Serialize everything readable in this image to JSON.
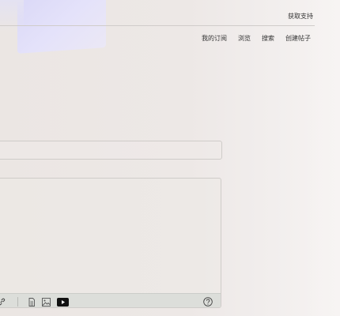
{
  "header": {
    "support_link": "获取支持"
  },
  "nav": {
    "items": [
      {
        "label": "我的订阅"
      },
      {
        "label": "浏览"
      },
      {
        "label": "搜索"
      },
      {
        "label": "创建帖子"
      }
    ]
  },
  "form": {
    "title_value": "",
    "body_value": ""
  },
  "toolbar": {
    "icons": [
      "link-icon",
      "document-icon",
      "image-icon",
      "video-icon",
      "help-icon"
    ]
  }
}
